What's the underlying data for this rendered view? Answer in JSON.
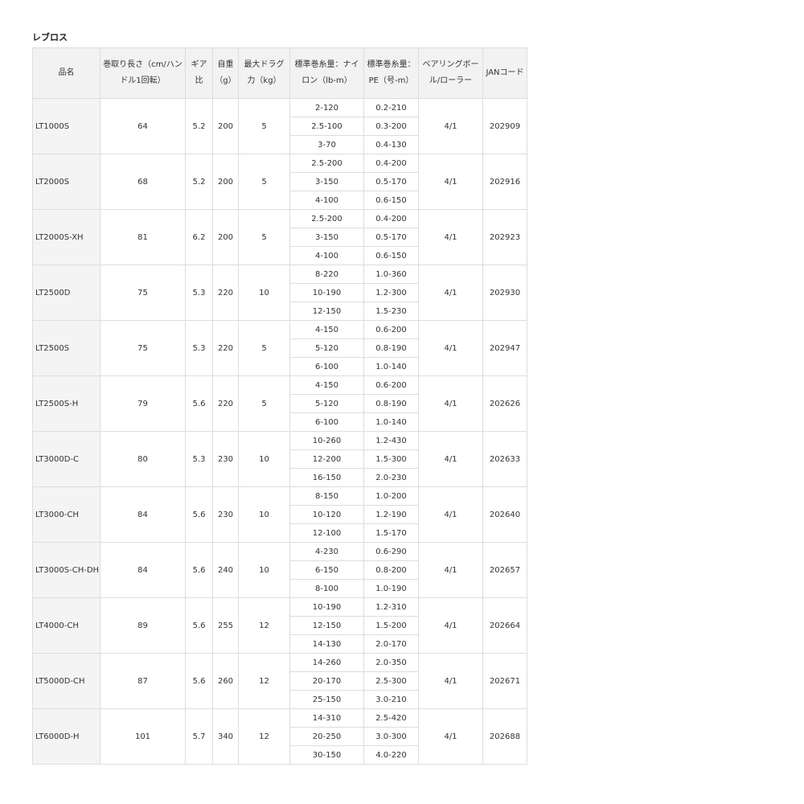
{
  "title": "レブロス",
  "headers": {
    "name": "品名",
    "winding": "巻取り長さ（cm/ハンドル1回転）",
    "gear": "ギア比",
    "weight": "自重（g）",
    "drag": "最大ドラグ力（kg）",
    "nylon": "標準巻糸量：ナイロン（lb-m）",
    "pe": "標準巻糸量：PE（号-m）",
    "bearing": "ベアリングボール/ローラー",
    "jan": "JANコード"
  },
  "rows": [
    {
      "name": "LT1000S",
      "winding": "64",
      "gear": "5.2",
      "weight": "200",
      "drag": "5",
      "nylon": [
        "2-120",
        "2.5-100",
        "3-70"
      ],
      "pe": [
        "0.2-210",
        "0.3-200",
        "0.4-130"
      ],
      "bearing": "4/1",
      "jan": "202909"
    },
    {
      "name": "LT2000S",
      "winding": "68",
      "gear": "5.2",
      "weight": "200",
      "drag": "5",
      "nylon": [
        "2.5-200",
        "3-150",
        "4-100"
      ],
      "pe": [
        "0.4-200",
        "0.5-170",
        "0.6-150"
      ],
      "bearing": "4/1",
      "jan": "202916"
    },
    {
      "name": "LT2000S-XH",
      "winding": "81",
      "gear": "6.2",
      "weight": "200",
      "drag": "5",
      "nylon": [
        "2.5-200",
        "3-150",
        "4-100"
      ],
      "pe": [
        "0.4-200",
        "0.5-170",
        "0.6-150"
      ],
      "bearing": "4/1",
      "jan": "202923"
    },
    {
      "name": "LT2500D",
      "winding": "75",
      "gear": "5.3",
      "weight": "220",
      "drag": "10",
      "nylon": [
        "8-220",
        "10-190",
        "12-150"
      ],
      "pe": [
        "1.0-360",
        "1.2-300",
        "1.5-230"
      ],
      "bearing": "4/1",
      "jan": "202930"
    },
    {
      "name": "LT2500S",
      "winding": "75",
      "gear": "5.3",
      "weight": "220",
      "drag": "5",
      "nylon": [
        "4-150",
        "5-120",
        "6-100"
      ],
      "pe": [
        "0.6-200",
        "0.8-190",
        "1.0-140"
      ],
      "bearing": "4/1",
      "jan": "202947"
    },
    {
      "name": "LT2500S-H",
      "winding": "79",
      "gear": "5.6",
      "weight": "220",
      "drag": "5",
      "nylon": [
        "4-150",
        "5-120",
        "6-100"
      ],
      "pe": [
        "0.6-200",
        "0.8-190",
        "1.0-140"
      ],
      "bearing": "4/1",
      "jan": "202626"
    },
    {
      "name": "LT3000D-C",
      "winding": "80",
      "gear": "5.3",
      "weight": "230",
      "drag": "10",
      "nylon": [
        "10-260",
        "12-200",
        "16-150"
      ],
      "pe": [
        "1.2-430",
        "1.5-300",
        "2.0-230"
      ],
      "bearing": "4/1",
      "jan": "202633"
    },
    {
      "name": "LT3000-CH",
      "winding": "84",
      "gear": "5.6",
      "weight": "230",
      "drag": "10",
      "nylon": [
        "8-150",
        "10-120",
        "12-100"
      ],
      "pe": [
        "1.0-200",
        "1.2-190",
        "1.5-170"
      ],
      "bearing": "4/1",
      "jan": "202640"
    },
    {
      "name": "LT3000S-CH-DH",
      "winding": "84",
      "gear": "5.6",
      "weight": "240",
      "drag": "10",
      "nylon": [
        "4-230",
        "6-150",
        "8-100"
      ],
      "pe": [
        "0.6-290",
        "0.8-200",
        "1.0-190"
      ],
      "bearing": "4/1",
      "jan": "202657"
    },
    {
      "name": "LT4000-CH",
      "winding": "89",
      "gear": "5.6",
      "weight": "255",
      "drag": "12",
      "nylon": [
        "10-190",
        "12-150",
        "14-130"
      ],
      "pe": [
        "1.2-310",
        "1.5-200",
        "2.0-170"
      ],
      "bearing": "4/1",
      "jan": "202664"
    },
    {
      "name": "LT5000D-CH",
      "winding": "87",
      "gear": "5.6",
      "weight": "260",
      "drag": "12",
      "nylon": [
        "14-260",
        "20-170",
        "25-150"
      ],
      "pe": [
        "2.0-350",
        "2.5-300",
        "3.0-210"
      ],
      "bearing": "4/1",
      "jan": "202671"
    },
    {
      "name": "LT6000D-H",
      "winding": "101",
      "gear": "5.7",
      "weight": "340",
      "drag": "12",
      "nylon": [
        "14-310",
        "20-250",
        "30-150"
      ],
      "pe": [
        "2.5-420",
        "3.0-300",
        "4.0-220"
      ],
      "bearing": "4/1",
      "jan": "202688"
    }
  ]
}
